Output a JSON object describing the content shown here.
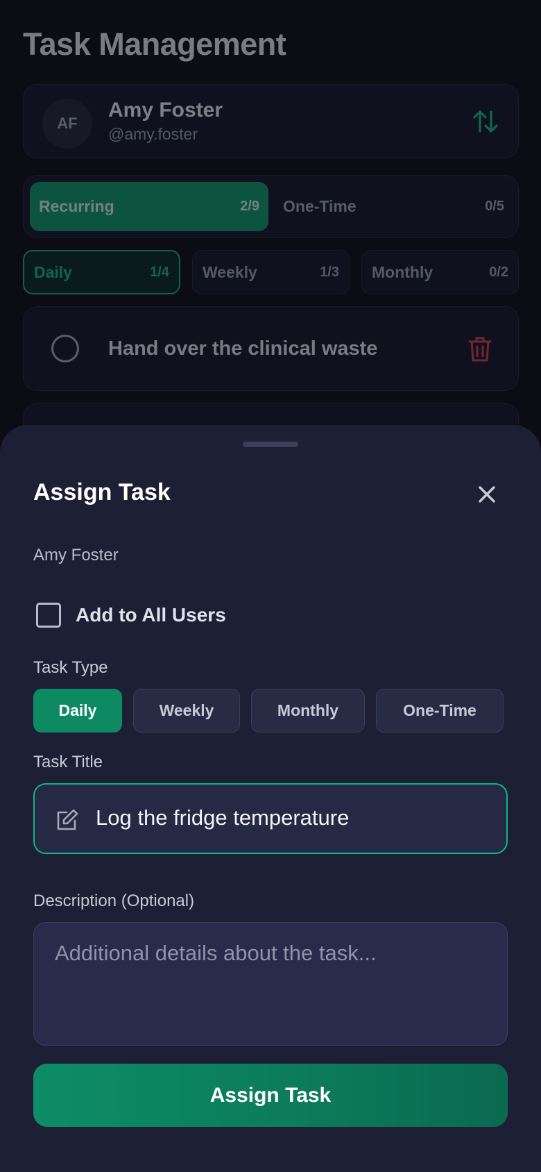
{
  "page": {
    "title": "Task Management",
    "user": {
      "initials": "AF",
      "name": "Amy Foster",
      "handle": "@amy.foster"
    },
    "segments": [
      {
        "label": "Recurring",
        "count": "2/9",
        "active": true
      },
      {
        "label": "One-Time",
        "count": "0/5",
        "active": false
      }
    ],
    "filters": [
      {
        "label": "Daily",
        "count": "1/4",
        "active": true
      },
      {
        "label": "Weekly",
        "count": "1/3",
        "active": false
      },
      {
        "label": "Monthly",
        "count": "0/2",
        "active": false
      }
    ],
    "tasks": [
      {
        "title": "Hand over the clinical waste",
        "done": false
      }
    ]
  },
  "sheet": {
    "title": "Assign Task",
    "assignee": "Amy Foster",
    "add_all_label": "Add to All Users",
    "add_all_checked": false,
    "task_type_label": "Task Type",
    "task_types": [
      {
        "label": "Daily",
        "active": true
      },
      {
        "label": "Weekly",
        "active": false
      },
      {
        "label": "Monthly",
        "active": false
      },
      {
        "label": "One-Time",
        "active": false
      }
    ],
    "task_title_label": "Task Title",
    "task_title_value": "Log the fridge temperature",
    "description_label": "Description (Optional)",
    "description_placeholder": "Additional details about the task...",
    "submit_label": "Assign Task"
  },
  "colors": {
    "accent": "#0e8a62",
    "accent_bright": "#14b487",
    "danger": "#d9424a",
    "sheet_bg": "#1d2035",
    "page_bg": "#0b0c14"
  }
}
